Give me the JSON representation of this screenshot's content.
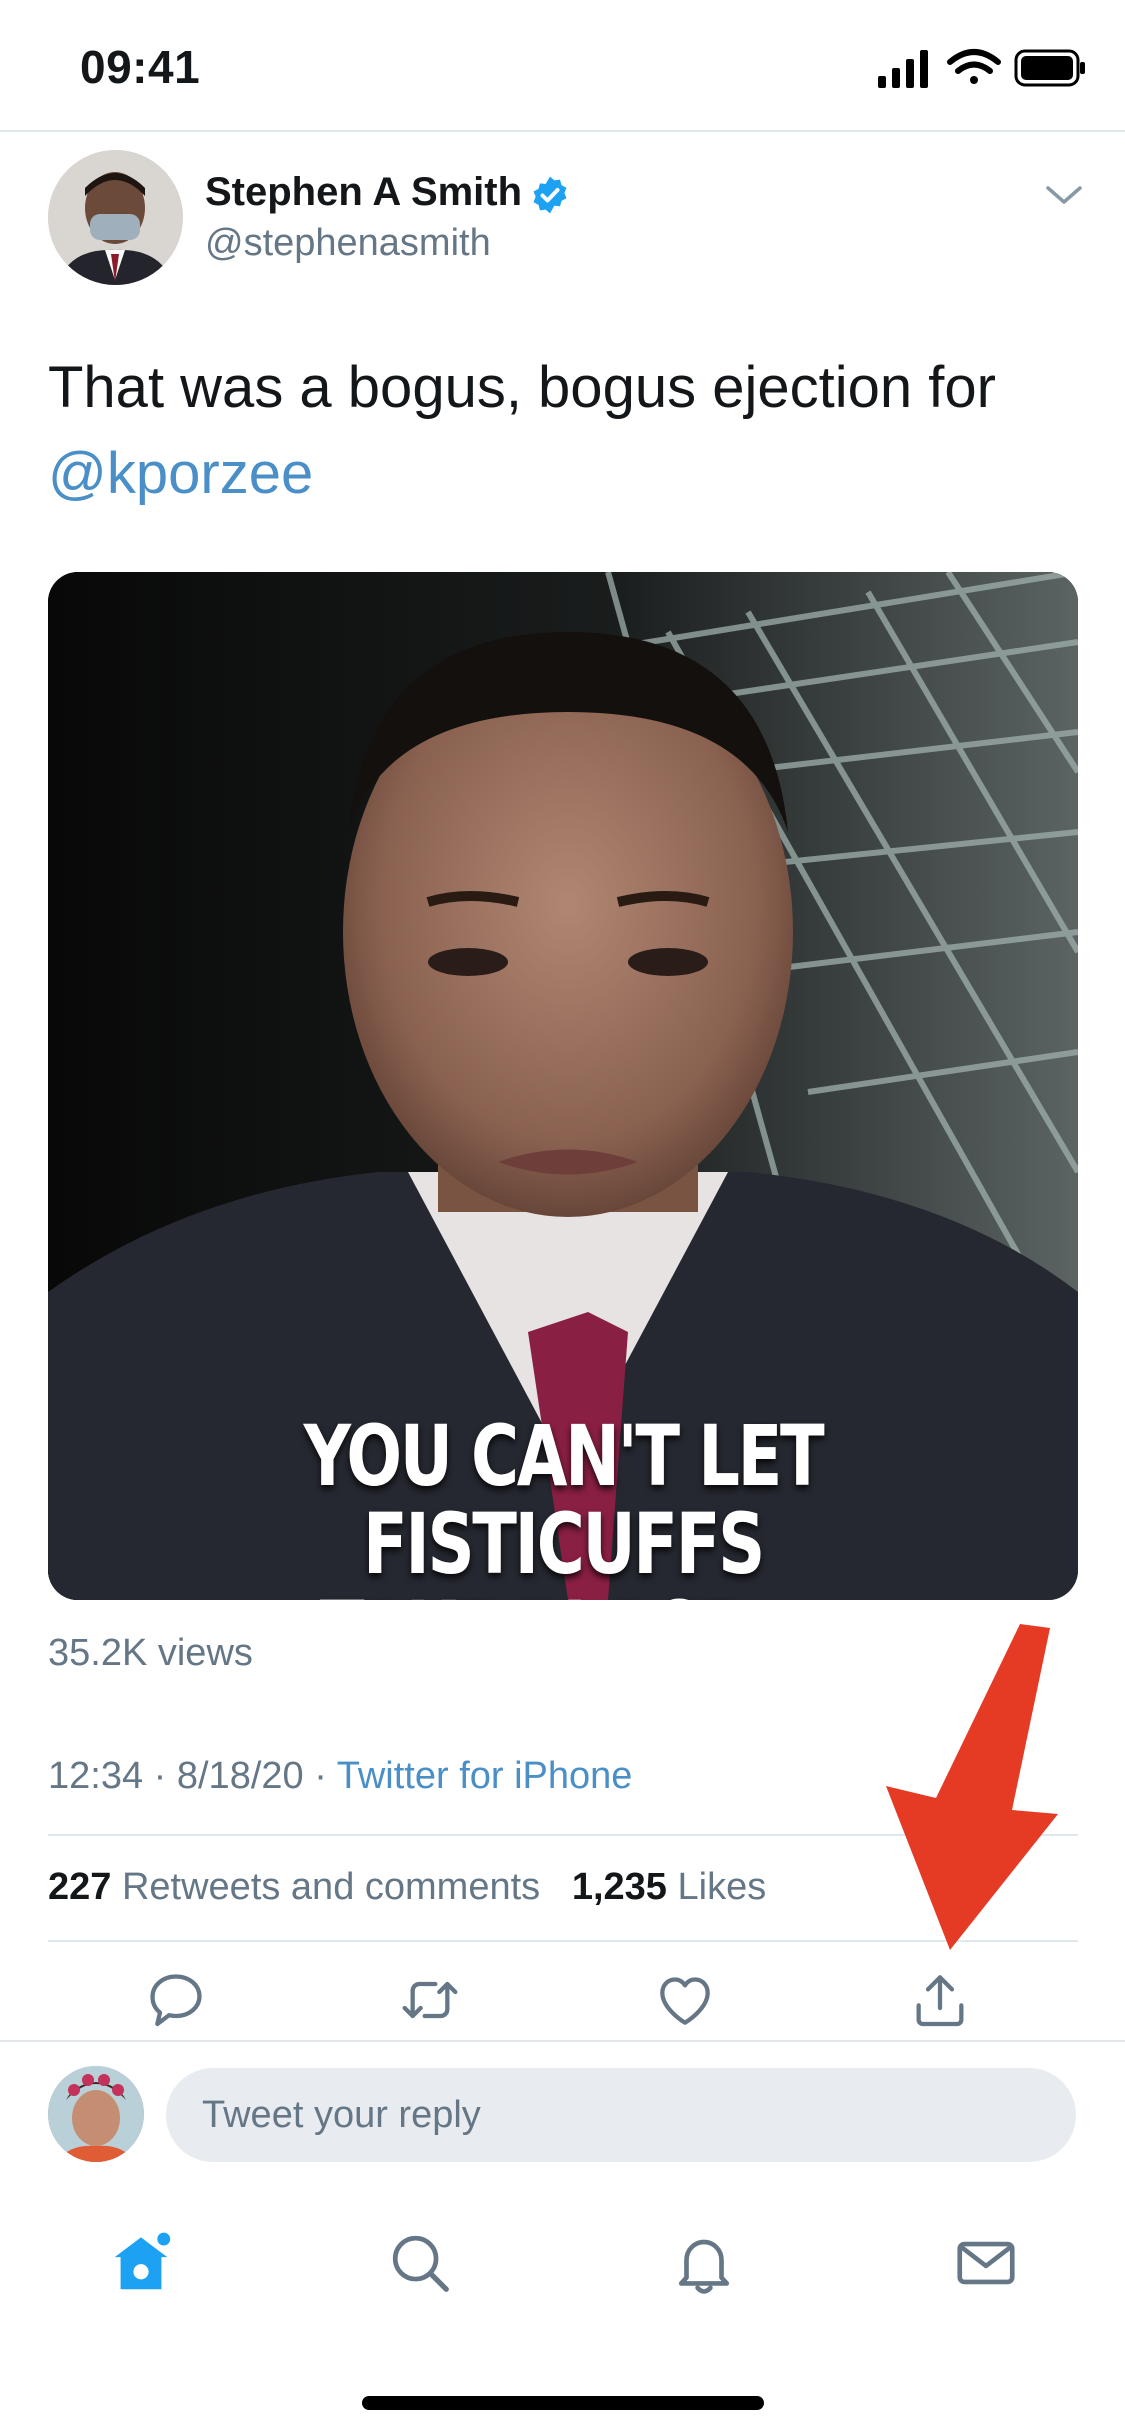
{
  "status_bar": {
    "time": "09:41"
  },
  "tweet": {
    "display_name": "Stephen A Smith",
    "handle": "@stephenasmith",
    "text": "That was a bogus, bogus ejection for",
    "mention": "@kporzee",
    "video_caption_line1": "YOU CAN'T LET FISTICUFFS",
    "video_caption_line2": "TAKE PLACE...",
    "views": "35.2K views",
    "timestamp": "12:34 · 8/18/20 · ",
    "source": "Twitter for iPhone",
    "retweets_count": "227",
    "retweets_label": "Retweets and comments",
    "likes_count": "1,235",
    "likes_label": "Likes"
  },
  "reply": {
    "placeholder": "Tweet your reply"
  },
  "icons": {
    "verified": "verified-badge-icon",
    "caret": "chevron-down-icon",
    "reply": "comment-icon",
    "retweet": "retweet-icon",
    "like": "heart-icon",
    "share": "share-icon",
    "home": "home-icon",
    "search": "search-icon",
    "notifications": "bell-icon",
    "messages": "mail-icon"
  },
  "colors": {
    "link": "#4a8fc7",
    "verified": "#1da1f2",
    "annotation_arrow": "#e53a24",
    "secondary_text": "#657786"
  }
}
